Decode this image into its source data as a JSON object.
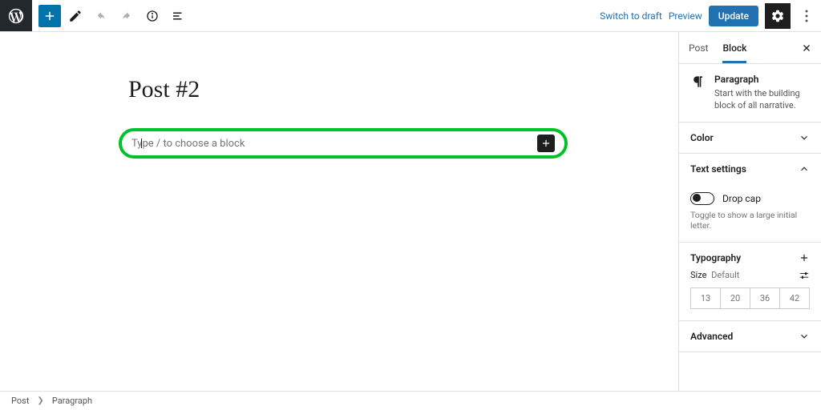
{
  "toolbar": {
    "switch_to_draft": "Switch to draft",
    "preview": "Preview",
    "update": "Update"
  },
  "editor": {
    "title": "Post #2",
    "block_placeholder": "Type / to choose a block"
  },
  "sidebar": {
    "tab_post": "Post",
    "tab_block": "Block",
    "block_name": "Paragraph",
    "block_desc": "Start with the building block of all narrative.",
    "panel_color": "Color",
    "panel_text_settings": "Text settings",
    "dropcap_label": "Drop cap",
    "dropcap_help": "Toggle to show a large initial letter.",
    "panel_typography": "Typography",
    "size_label": "Size",
    "size_default": "Default",
    "size_options": [
      "13",
      "20",
      "36",
      "42"
    ],
    "panel_advanced": "Advanced"
  },
  "breadcrumb": {
    "item1": "Post",
    "item2": "Paragraph"
  }
}
